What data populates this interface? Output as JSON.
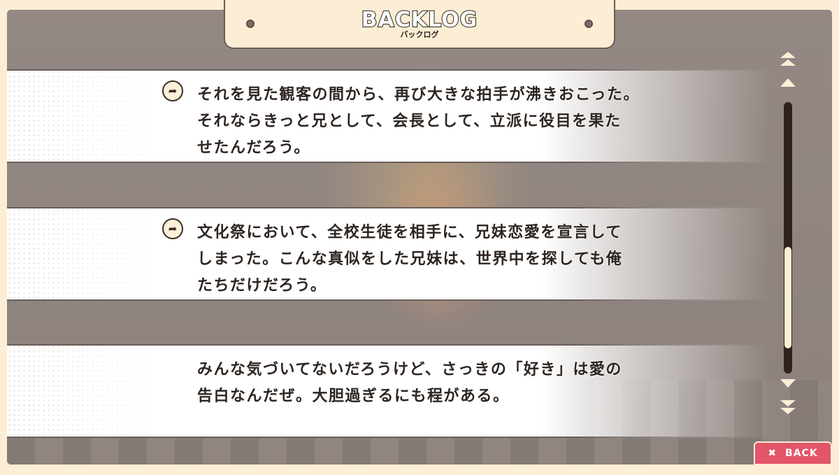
{
  "header": {
    "title": "BACKLOG",
    "subtitle": "バックログ"
  },
  "entries": [
    {
      "has_voice": true,
      "lines": [
        "それを見た観客の間から、再び大きな拍手が沸きおこった。",
        "それならきっと兄として、会長として、立派に役目を果た",
        "せたんだろう。"
      ]
    },
    {
      "has_voice": true,
      "lines": [
        "文化祭において、全校生徒を相手に、兄妹恋愛を宣言して",
        "しまった。こんな真似をした兄妹は、世界中を探しても俺",
        "たちだけだろう。"
      ]
    },
    {
      "has_voice": false,
      "lines": [
        "みんな気づいてないだろうけど、さっきの「好き」は愛の",
        "告白なんだぜ。大胆過ぎるにも程がある。"
      ]
    }
  ],
  "icons": {
    "voice": "voice-replay-icon",
    "scroll_top": "double-up-arrow-icon",
    "scroll_up": "up-arrow-icon",
    "scroll_down": "down-arrow-icon",
    "scroll_bottom": "double-down-arrow-icon",
    "back": "close-icon"
  },
  "scroll": {
    "position_fraction": 0.85
  },
  "footer": {
    "back_label": "BACK"
  },
  "colors": {
    "panel": "#fbeed4",
    "back_button": "#e35569",
    "text": "#2e2520"
  }
}
